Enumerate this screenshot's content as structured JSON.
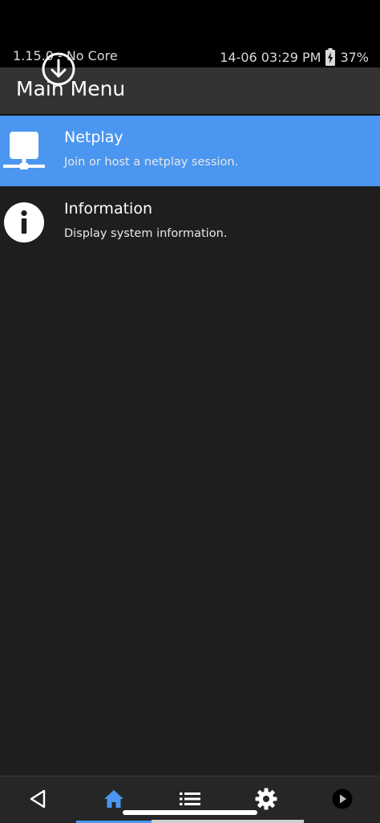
{
  "status_bar": {
    "left_text": "1.15.0 - No Core",
    "datetime": "14-06 03:29 PM",
    "battery": "37%"
  },
  "header": {
    "title": "Main Menu"
  },
  "menu": {
    "items": [
      {
        "title": "Netplay",
        "subtitle": "Join or host a netplay session.",
        "icon": "network-icon",
        "selected": true
      },
      {
        "title": "Information",
        "subtitle": "Display system information.",
        "icon": "info-icon",
        "selected": false
      }
    ]
  },
  "bottom_nav": {
    "items": [
      {
        "icon": "back-icon"
      },
      {
        "icon": "home-icon",
        "active": true
      },
      {
        "icon": "list-icon"
      },
      {
        "icon": "settings-icon"
      },
      {
        "icon": "play-icon"
      }
    ]
  },
  "colors": {
    "accent": "#4a96f0",
    "background": "#1e1e1e",
    "header": "#333333",
    "status_bar": "#000000"
  }
}
